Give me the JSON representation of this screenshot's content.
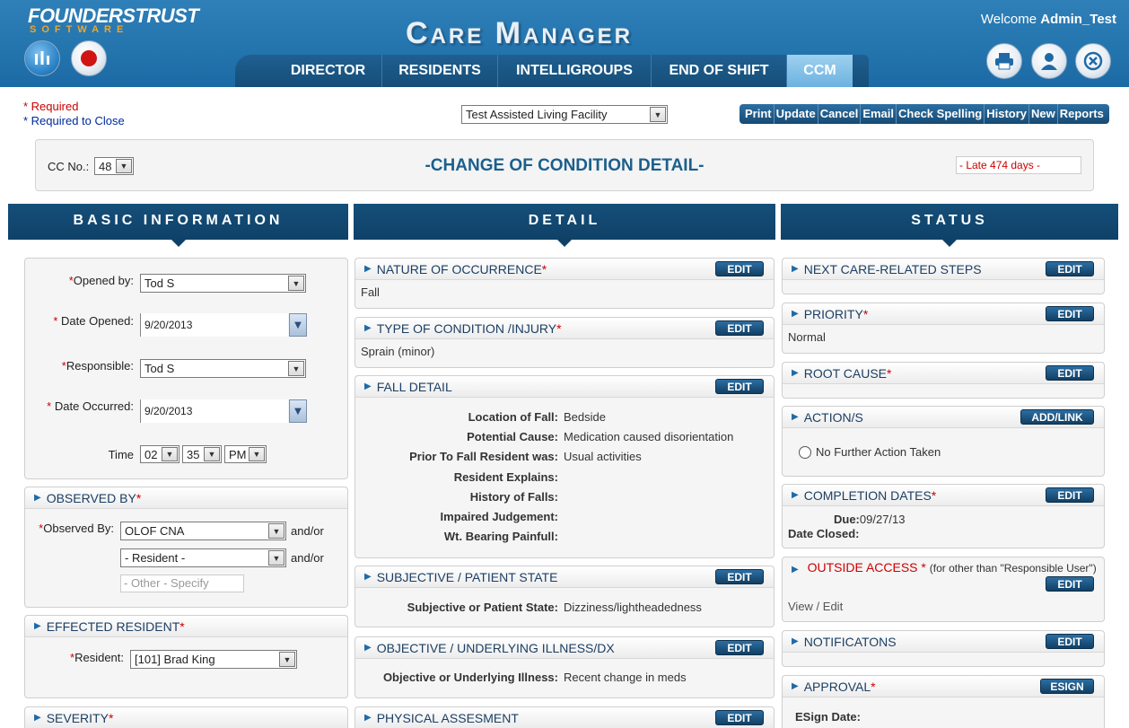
{
  "header": {
    "logo_main": "FOUNDERSTRUST",
    "logo_sub": "SOFTWARE",
    "app_title": "Care Manager",
    "welcome_prefix": "Welcome",
    "username": "Admin_Test"
  },
  "nav": {
    "tabs": [
      {
        "label": "DIRECTOR"
      },
      {
        "label": "RESIDENTS"
      },
      {
        "label": "INTELLIGROUPS"
      },
      {
        "label": "END OF SHIFT"
      },
      {
        "label": "CCM"
      }
    ],
    "active": "CCM"
  },
  "legend": {
    "required": "* Required",
    "required_close": "* Required to Close"
  },
  "facility": {
    "selected": "Test Assisted Living Facility"
  },
  "toolbar": [
    "Print",
    "Update",
    "Cancel",
    "Email",
    "Check Spelling",
    "History",
    "New",
    "Reports"
  ],
  "cc": {
    "label": "CC No.:",
    "number": "48",
    "title": "-CHANGE OF CONDITION DETAIL-",
    "late": "- Late 474 days -"
  },
  "columns": {
    "basic": "BASIC INFORMATION",
    "detail": "DETAIL",
    "status": "STATUS"
  },
  "basic": {
    "opened_by_label": "Opened by:",
    "opened_by": "Tod S",
    "date_opened_label": "Date Opened:",
    "date_opened": "9/20/2013",
    "responsible_label": "Responsible:",
    "responsible": "Tod S",
    "date_occurred_label": "Date Occurred:",
    "date_occurred": "9/20/2013",
    "time_label": "Time",
    "time_hour": "02",
    "time_min": "35",
    "time_ampm": "PM"
  },
  "observed": {
    "title": "OBSERVED BY",
    "label": "Observed By:",
    "first": "OLOF CNA",
    "second": "- Resident -",
    "andor": "and/or",
    "other_placeholder": "- Other - Specify"
  },
  "effected": {
    "title": "EFFECTED RESIDENT",
    "label": "Resident:",
    "value": "[101] Brad King"
  },
  "severity": {
    "title": "SEVERITY"
  },
  "detail": {
    "edit_label": "EDIT",
    "nature": {
      "title": "NATURE OF OCCURRENCE",
      "value": "Fall"
    },
    "type": {
      "title": "TYPE OF CONDITION /INJURY",
      "value": "Sprain (minor)"
    },
    "fall": {
      "title": "FALL DETAIL",
      "rows": [
        {
          "k": "Location of Fall:",
          "v": "Bedside"
        },
        {
          "k": "Potential Cause:",
          "v": "Medication caused disorientation"
        },
        {
          "k": "Prior To Fall Resident was:",
          "v": "Usual activities"
        },
        {
          "k": "Resident Explains:",
          "v": ""
        },
        {
          "k": "History of Falls:",
          "v": ""
        },
        {
          "k": "Impaired Judgement:",
          "v": ""
        },
        {
          "k": "Wt. Bearing Painfull:",
          "v": ""
        }
      ]
    },
    "subjective": {
      "title": "SUBJECTIVE / PATIENT STATE",
      "k": "Subjective or Patient State:",
      "v": "Dizziness/lightheadedness"
    },
    "objective": {
      "title": "OBJECTIVE / UNDERLYING ILLNESS/DX",
      "k": "Objective or Underlying Illness:",
      "v": "Recent change in meds"
    },
    "physical": {
      "title": "PHYSICAL ASSESMENT"
    }
  },
  "status": {
    "edit_label": "EDIT",
    "next_steps": {
      "title": "NEXT CARE-RELATED STEPS"
    },
    "priority": {
      "title": "PRIORITY",
      "value": "Normal"
    },
    "root_cause": {
      "title": "ROOT CAUSE"
    },
    "actions": {
      "title": "ACTION/S",
      "button": "ADD/LINK",
      "option": "No Further Action Taken"
    },
    "completion": {
      "title": "COMPLETION DATES",
      "due_label": "Due:",
      "due": "09/27/13",
      "closed_label": "Date Closed:"
    },
    "outside": {
      "title": "OUTSIDE ACCESS",
      "note": "(for other than \"Responsible User\")",
      "value": "View / Edit"
    },
    "notifications": {
      "title": "NOTIFICATONS"
    },
    "approval": {
      "title": "APPROVAL",
      "button": "ESIGN",
      "esign_label": "ESign Date:"
    }
  }
}
